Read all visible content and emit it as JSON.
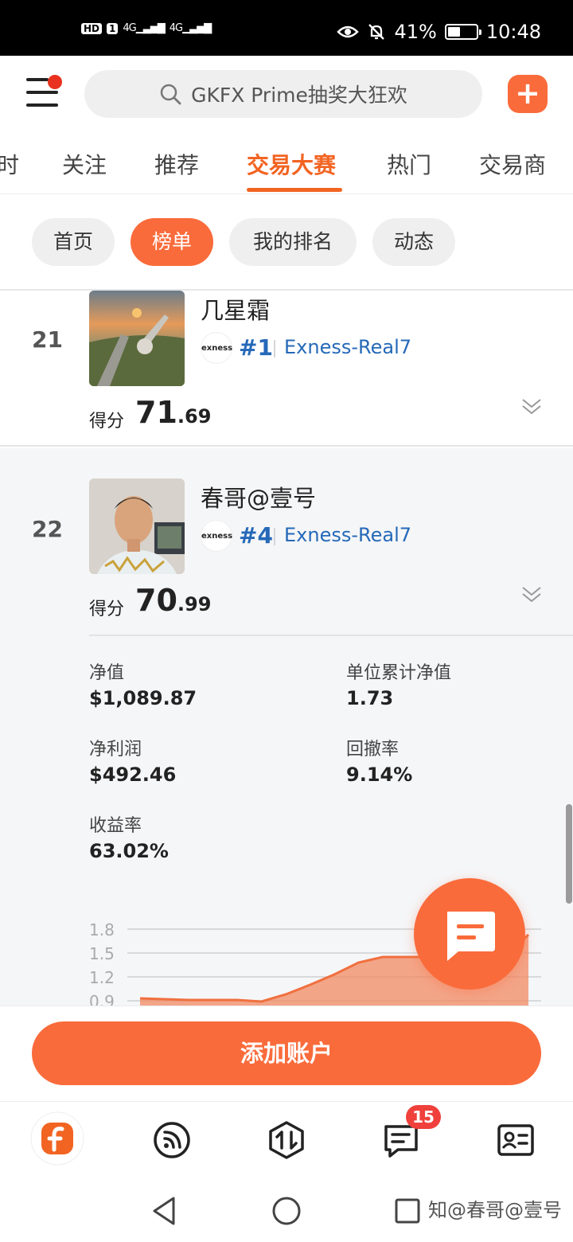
{
  "status_bar": {
    "left_badges": [
      "HD",
      "1",
      "4G",
      "4G"
    ],
    "battery": "41%",
    "battery_level": 0.41,
    "time": "10:48"
  },
  "header": {
    "search_text": "GKFX Prime抽奖大狂欢",
    "plus_label": "+"
  },
  "top_tabs": [
    {
      "label": "时"
    },
    {
      "label": "关注"
    },
    {
      "label": "推荐"
    },
    {
      "label": "交易大赛",
      "active": true
    },
    {
      "label": "热门"
    },
    {
      "label": "交易商"
    }
  ],
  "sub_tabs": [
    {
      "label": "首页"
    },
    {
      "label": "榜单",
      "active": true
    },
    {
      "label": "我的排名"
    },
    {
      "label": "动态"
    }
  ],
  "rows": [
    {
      "rank": "21",
      "name": "几星霜",
      "broker_rank": "#1",
      "account": "Exness-Real7",
      "score_label": "得分",
      "score_int": "71",
      "score_dec": ".69"
    },
    {
      "rank": "22",
      "name": "春哥@壹号",
      "broker_rank": "#4",
      "account": "Exness-Real7",
      "score_label": "得分",
      "score_int": "70",
      "score_dec": ".99",
      "stats": {
        "net_value_label": "净值",
        "net_value": "$1,089.87",
        "unit_nav_label": "单位累计净值",
        "unit_nav": "1.73",
        "net_profit_label": "净利润",
        "net_profit": "$492.46",
        "drawdown_label": "回撤率",
        "drawdown": "9.14%",
        "return_label": "收益率",
        "return": "63.02%"
      }
    }
  ],
  "broker_logo_text": "exness",
  "chart_data": {
    "type": "area",
    "y_ticks": [
      "1.8",
      "1.5",
      "1.2",
      "0.9"
    ],
    "ylim": [
      0.9,
      1.8
    ],
    "values": [
      0.93,
      0.92,
      0.91,
      0.91,
      0.91,
      0.89,
      0.98,
      1.1,
      1.23,
      1.38,
      1.45,
      1.45,
      1.45,
      1.45,
      1.45,
      1.46,
      1.73
    ],
    "color": "#f28a63",
    "grid": true
  },
  "bottom": {
    "add_account_label": "添加账户",
    "messages_badge": "15",
    "watermark": "知@春哥@壹号"
  },
  "colors": {
    "accent": "#fa6b3b",
    "link": "#2569b8"
  }
}
